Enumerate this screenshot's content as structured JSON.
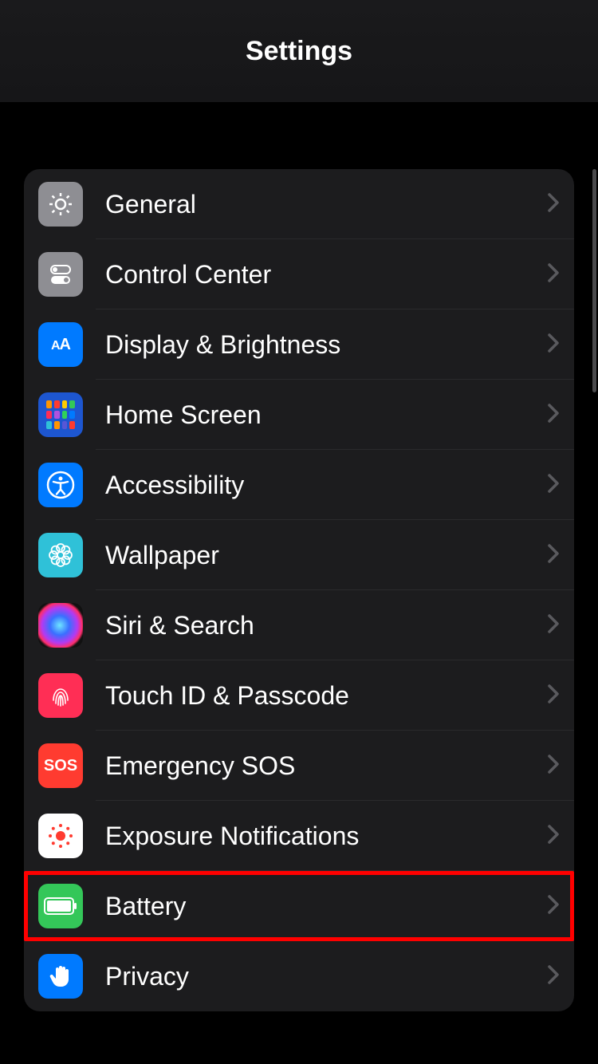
{
  "header": {
    "title": "Settings"
  },
  "section": {
    "items": [
      {
        "id": "general",
        "label": "General",
        "icon": "gear-icon",
        "bg": "bg-gray",
        "highlighted": false
      },
      {
        "id": "control-center",
        "label": "Control Center",
        "icon": "toggles-icon",
        "bg": "bg-gray",
        "highlighted": false
      },
      {
        "id": "display-brightness",
        "label": "Display & Brightness",
        "icon": "text-size-icon",
        "bg": "bg-blue",
        "highlighted": false
      },
      {
        "id": "home-screen",
        "label": "Home Screen",
        "icon": "app-grid-icon",
        "bg": "bg-darkblue",
        "highlighted": false
      },
      {
        "id": "accessibility",
        "label": "Accessibility",
        "icon": "accessibility-icon",
        "bg": "bg-blue",
        "highlighted": false
      },
      {
        "id": "wallpaper",
        "label": "Wallpaper",
        "icon": "flower-icon",
        "bg": "bg-cyan",
        "highlighted": false
      },
      {
        "id": "siri-search",
        "label": "Siri & Search",
        "icon": "siri-icon",
        "bg": "bg-siri",
        "highlighted": false
      },
      {
        "id": "touchid-passcode",
        "label": "Touch ID & Passcode",
        "icon": "fingerprint-icon",
        "bg": "bg-pink",
        "highlighted": false
      },
      {
        "id": "emergency-sos",
        "label": "Emergency SOS",
        "icon": "sos-icon",
        "bg": "bg-red",
        "highlighted": false
      },
      {
        "id": "exposure-notifications",
        "label": "Exposure Notifications",
        "icon": "exposure-icon",
        "bg": "bg-white",
        "highlighted": false
      },
      {
        "id": "battery",
        "label": "Battery",
        "icon": "battery-icon",
        "bg": "bg-green",
        "highlighted": true
      },
      {
        "id": "privacy",
        "label": "Privacy",
        "icon": "hand-icon",
        "bg": "bg-blue",
        "highlighted": false
      }
    ]
  }
}
